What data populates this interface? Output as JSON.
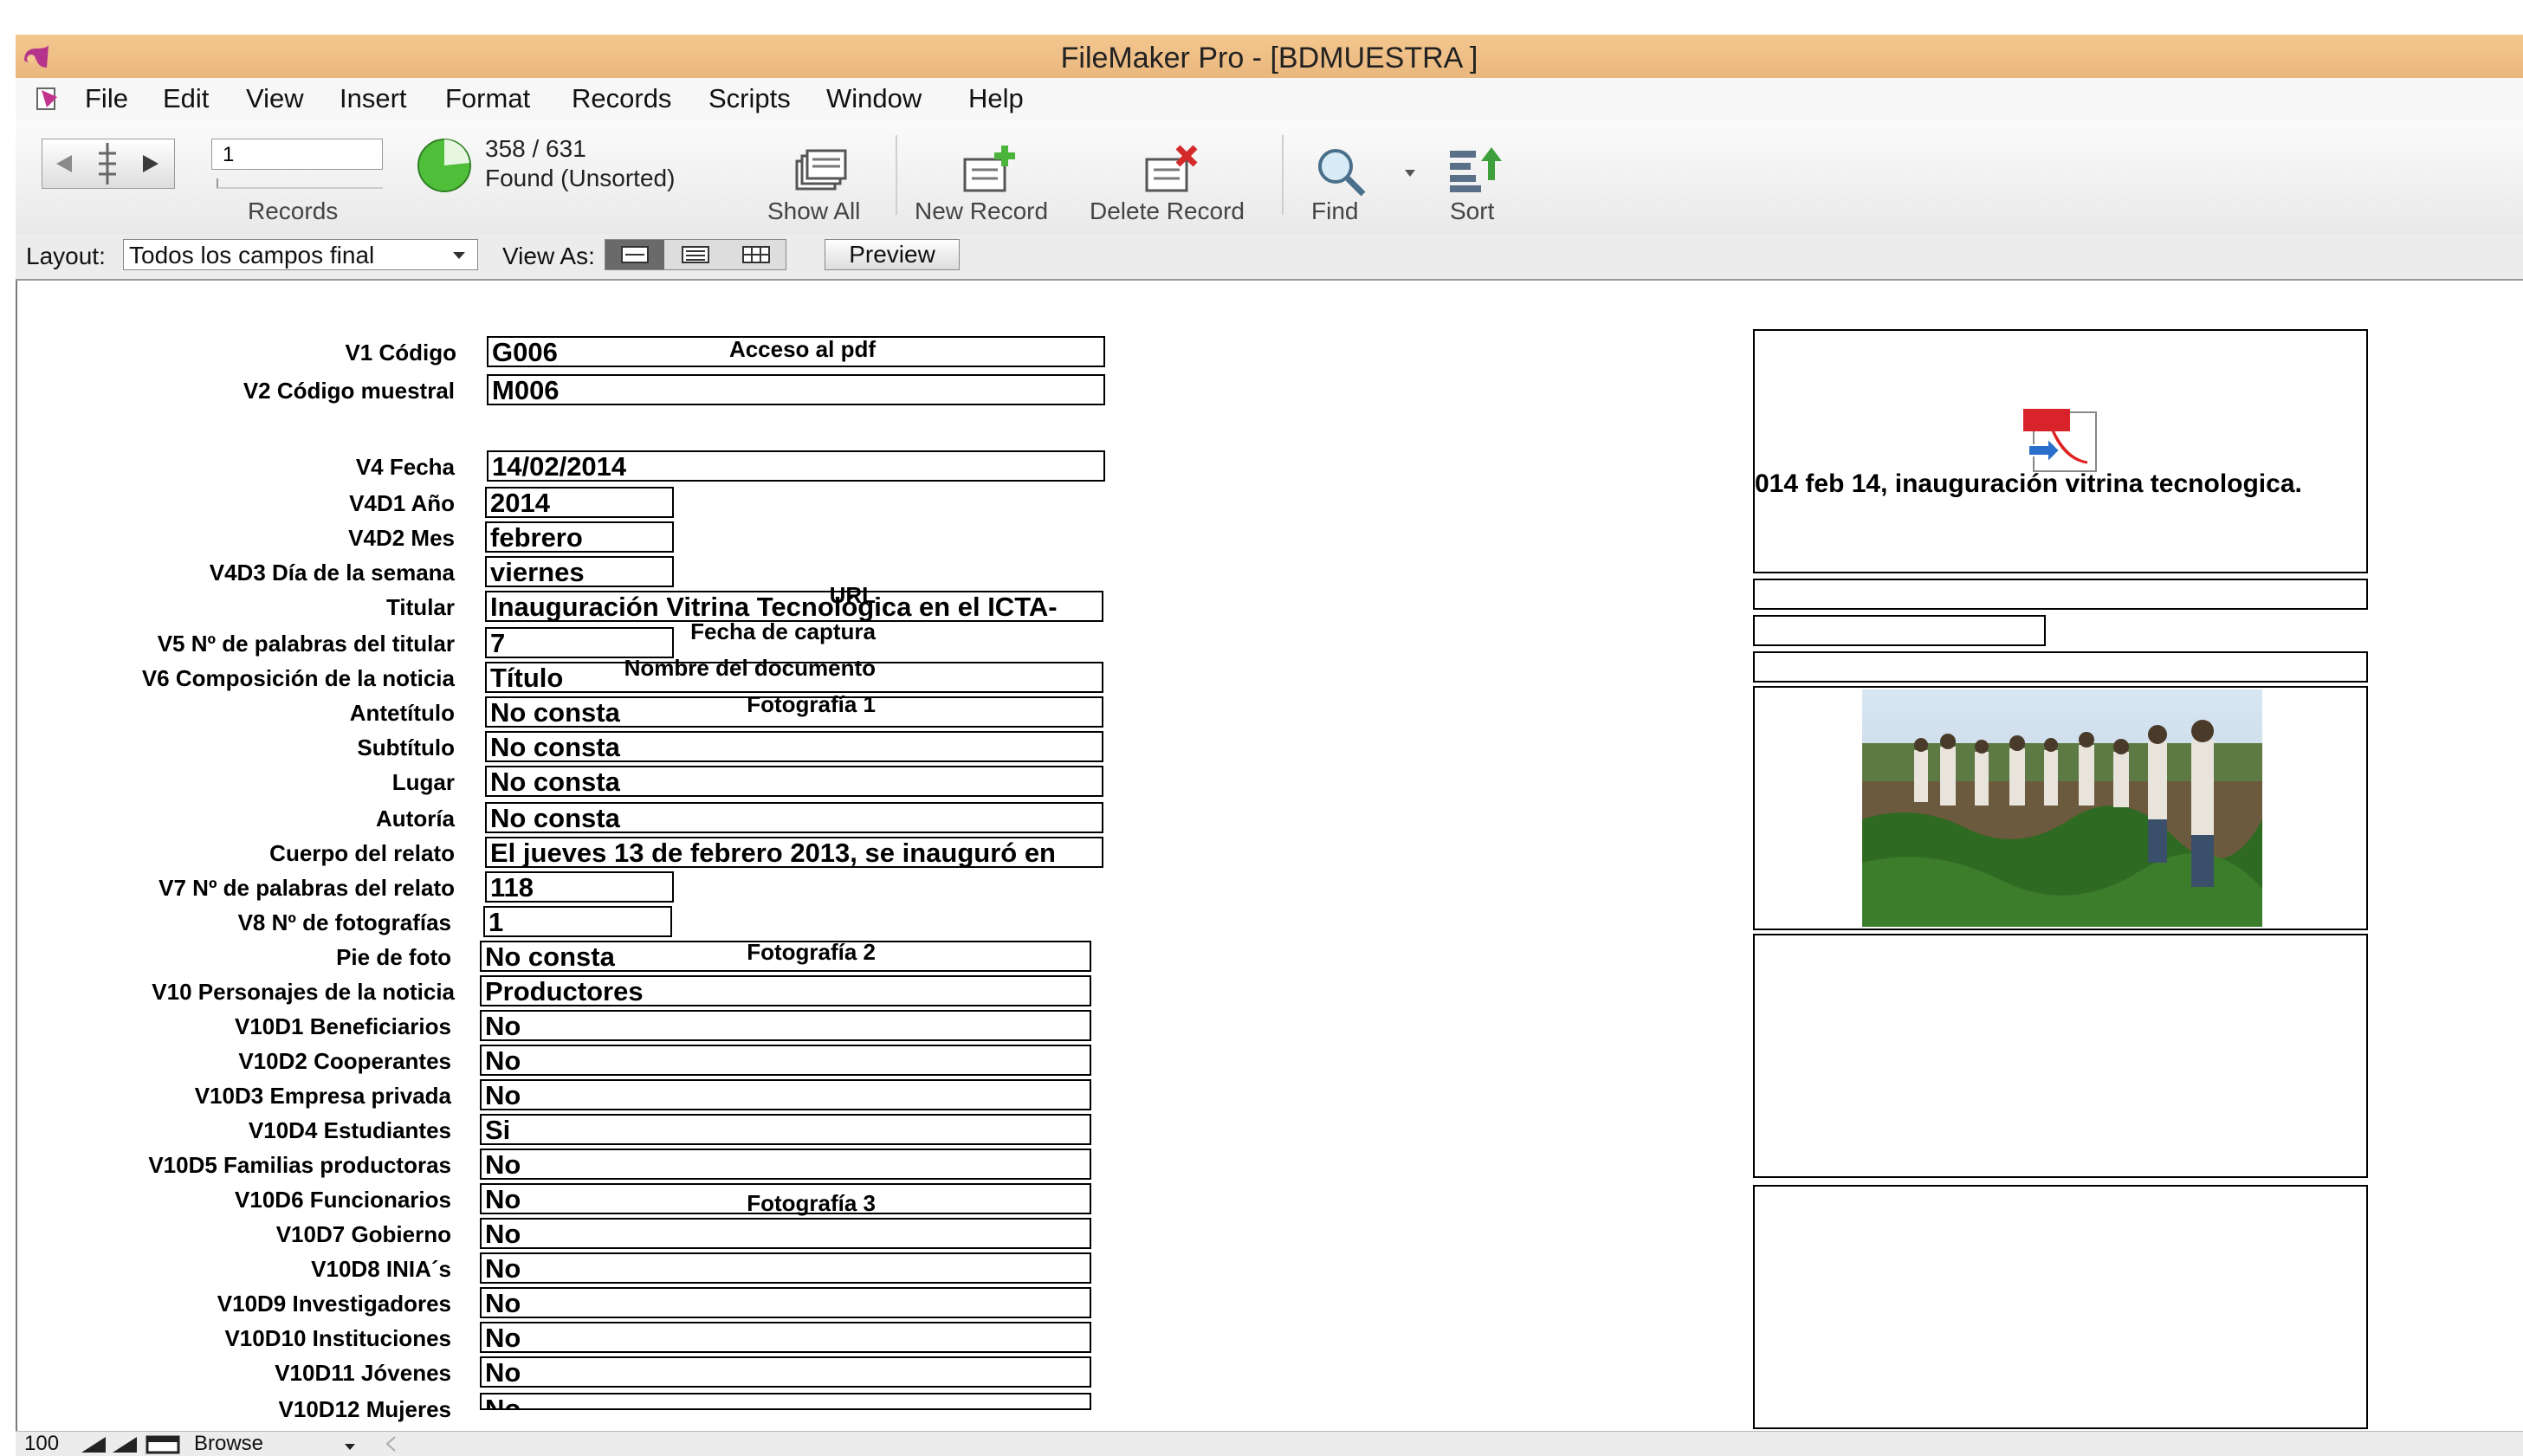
{
  "window": {
    "title": "FileMaker Pro - [BDMUESTRA ]"
  },
  "menu": [
    "File",
    "Edit",
    "View",
    "Insert",
    "Format",
    "Records",
    "Scripts",
    "Window",
    "Help"
  ],
  "toolbar": {
    "record_number": "1",
    "records_label": "Records",
    "found_count": "358 / 631",
    "found_status": "Found (Unsorted)",
    "show_all": "Show All",
    "new_record": "New Record",
    "delete_record": "Delete Record",
    "find": "Find",
    "sort": "Sort"
  },
  "layoutbar": {
    "layout_label": "Layout:",
    "layout_value": "Todos los campos final",
    "view_as_label": "View As:",
    "preview": "Preview"
  },
  "fields": [
    {
      "label": "V1 Código",
      "value": "G006"
    },
    {
      "label": "V2 Código muestral",
      "value": "M006"
    },
    {
      "label": "V4 Fecha",
      "value": "14/02/2014"
    },
    {
      "label": "V4D1 Año",
      "value": "2014"
    },
    {
      "label": "V4D2 Mes",
      "value": "febrero"
    },
    {
      "label": "V4D3 Día de la semana",
      "value": "viernes"
    },
    {
      "label": "Titular",
      "value": "Inauguración Vitrina Tecnológica en el ICTA-"
    },
    {
      "label": "V5 Nº de palabras del titular",
      "value": "7"
    },
    {
      "label": "V6 Composición de la noticia",
      "value": "Título"
    },
    {
      "label": "Antetítulo",
      "value": "No consta"
    },
    {
      "label": "Subtítulo",
      "value": "No consta"
    },
    {
      "label": "Lugar",
      "value": "No consta"
    },
    {
      "label": "Autoría",
      "value": "No consta"
    },
    {
      "label": "Cuerpo del relato",
      "value": "El jueves 13 de febrero 2013, se inauguró en"
    },
    {
      "label": "V7 Nº de palabras del relato",
      "value": "118"
    },
    {
      "label": "V8 Nº de fotografías",
      "value": "1"
    },
    {
      "label": "Pie de foto",
      "value": "No consta"
    },
    {
      "label": "V10 Personajes de la noticia",
      "value": "Productores"
    },
    {
      "label": "V10D1 Beneficiarios",
      "value": "No"
    },
    {
      "label": "V10D2 Cooperantes",
      "value": "No"
    },
    {
      "label": "V10D3 Empresa privada",
      "value": "No"
    },
    {
      "label": "V10D4 Estudiantes",
      "value": "Si"
    },
    {
      "label": "V10D5 Familias productoras",
      "value": "No"
    },
    {
      "label": "V10D6 Funcionarios",
      "value": "No"
    },
    {
      "label": "V10D7 Gobierno",
      "value": "No"
    },
    {
      "label": "V10D8 INIA´s",
      "value": "No"
    },
    {
      "label": "V10D9 Investigadores",
      "value": "No"
    },
    {
      "label": "V10D10 Instituciones",
      "value": "No"
    },
    {
      "label": "V10D11 Jóvenes",
      "value": "No"
    },
    {
      "label": "V10D12 Mujeres",
      "value": "No"
    }
  ],
  "right": {
    "pdf_label": "Acceso al pdf",
    "pdf_filename": "014 feb 14,  inauguración vitrina tecnologica.",
    "pdf_icon_text": "PDF",
    "url_label": "URL",
    "url_value": "",
    "capture_date_label": "Fecha de captura",
    "capture_date_value": "",
    "doc_name_label": "Nombre del documento",
    "doc_name_value": "",
    "photo1_label": "Fotografía 1",
    "photo2_label": "Fotografía 2",
    "photo3_label": "Fotografía 3"
  },
  "status": {
    "zoom": "100",
    "mode": "Browse"
  }
}
